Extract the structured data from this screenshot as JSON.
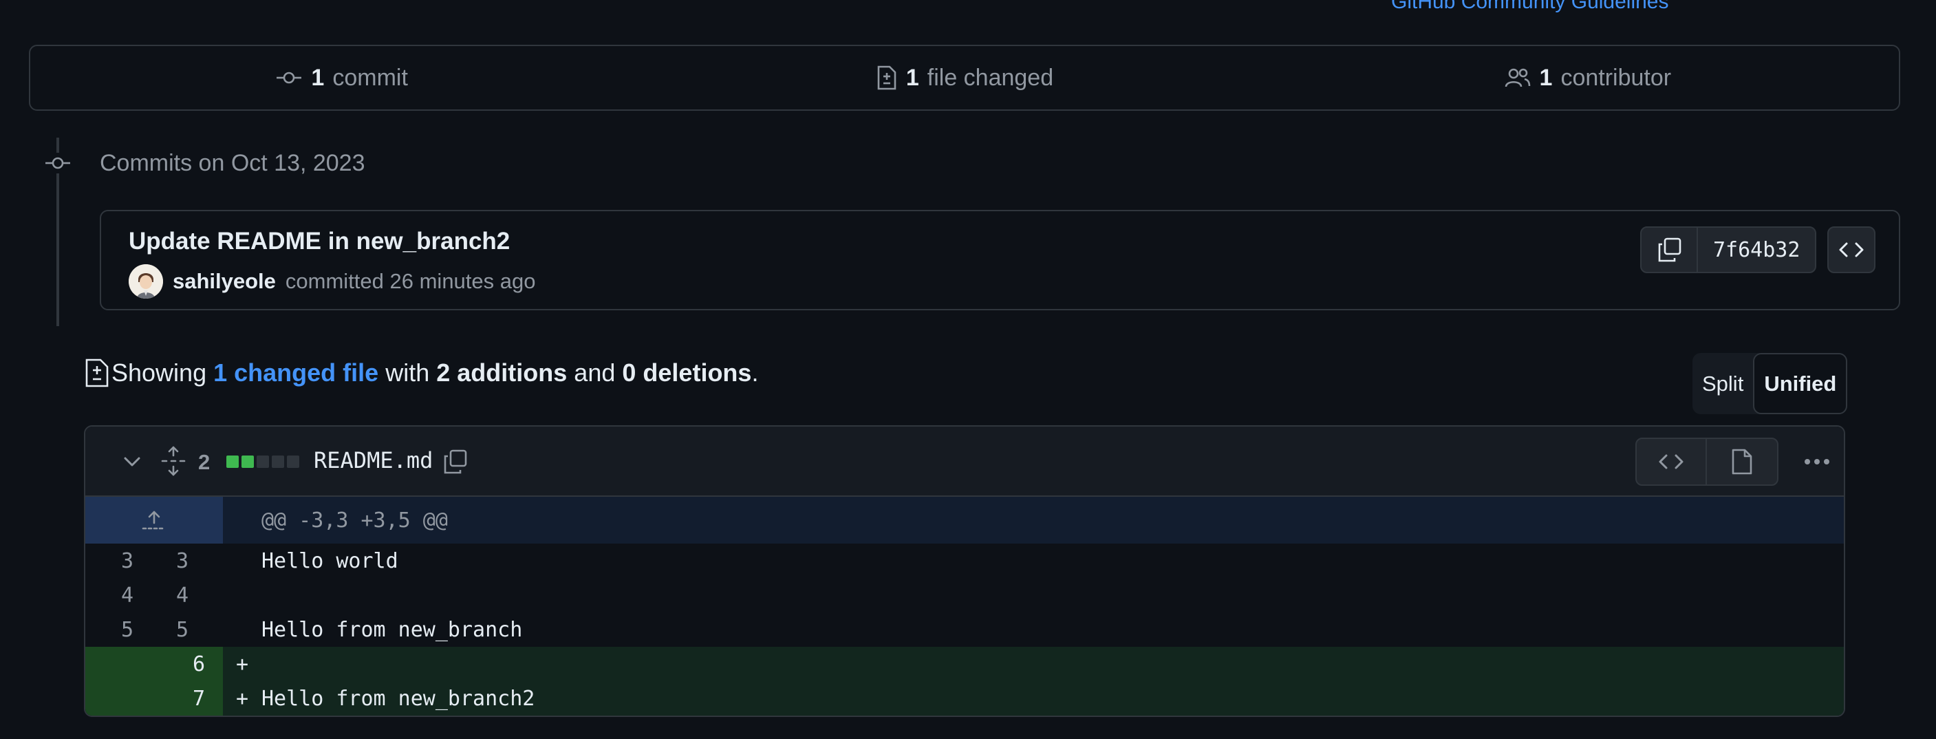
{
  "top_link": "GitHub Community Guidelines",
  "summary": {
    "commits_count": "1",
    "commits_label": "commit",
    "files_count": "1",
    "files_label": "file changed",
    "contributors_count": "1",
    "contributors_label": "contributor"
  },
  "timeline": {
    "heading": "Commits on Oct 13, 2023"
  },
  "commit": {
    "title": "Update README in new_branch2",
    "author": "sahilyeole",
    "meta": "committed 26 minutes ago",
    "sha": "7f64b32"
  },
  "showing": {
    "prefix": "Showing",
    "changed_link": "1 changed file",
    "with": "with",
    "additions": "2 additions",
    "and": "and",
    "deletions": "0 deletions",
    "period": "."
  },
  "view_toggle": {
    "split": "Split",
    "unified": "Unified",
    "selected": "Unified"
  },
  "file": {
    "changes": "2",
    "diffstat": [
      "add",
      "add",
      "neutral",
      "neutral",
      "neutral"
    ],
    "name": "README.md",
    "hunk_header": "@@ -3,3 +3,5 @@",
    "lines": [
      {
        "old": "3",
        "new": "3",
        "sign": "",
        "code": "Hello world",
        "type": "context"
      },
      {
        "old": "4",
        "new": "4",
        "sign": "",
        "code": "",
        "type": "context"
      },
      {
        "old": "5",
        "new": "5",
        "sign": "",
        "code": "Hello from new_branch",
        "type": "context"
      },
      {
        "old": "",
        "new": "6",
        "sign": "+",
        "code": "",
        "type": "add"
      },
      {
        "old": "",
        "new": "7",
        "sign": "+",
        "code": "Hello from new_branch2",
        "type": "add"
      }
    ]
  },
  "colors": {
    "background": "#0d1117",
    "link": "#4493f8",
    "addition_gutter": "#1b4721",
    "addition_line": "#12261e",
    "hunk_expander": "#1f3356"
  }
}
